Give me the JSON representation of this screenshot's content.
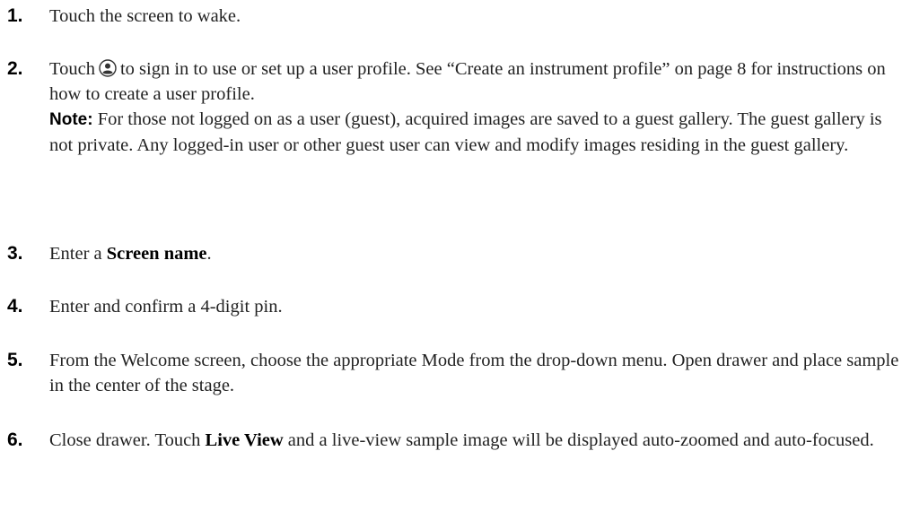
{
  "steps": [
    {
      "number": "1.",
      "text": "Touch the screen to wake."
    },
    {
      "number": "2.",
      "text_before_icon": "Touch",
      "icon": "user-profile-icon",
      "text_after_icon": "to sign in to use or set up a user profile. See “Create an instrument profile” on page 8 for instructions on how to create a user profile.",
      "note_label": "Note:",
      "note_text": "For those not logged on as a user (guest), acquired images are saved to a guest gallery. The guest gallery is not private. Any logged-in user or other guest user can view and modify images residing in the guest gallery."
    },
    {
      "number": "3.",
      "text_before": "Enter a",
      "bold": "Screen name",
      "text_after": "."
    },
    {
      "number": "4.",
      "text": "Enter and confirm a 4-digit pin."
    },
    {
      "number": "5.",
      "text": "From the Welcome screen, choose the appropriate Mode from the drop-down menu. Open drawer and place sample in the center of the stage."
    },
    {
      "number": "6.",
      "text_before": "Close drawer. Touch",
      "bold": "Live View",
      "text_after": "and a live-view sample image will be displayed auto-zoomed and auto-focused."
    }
  ]
}
